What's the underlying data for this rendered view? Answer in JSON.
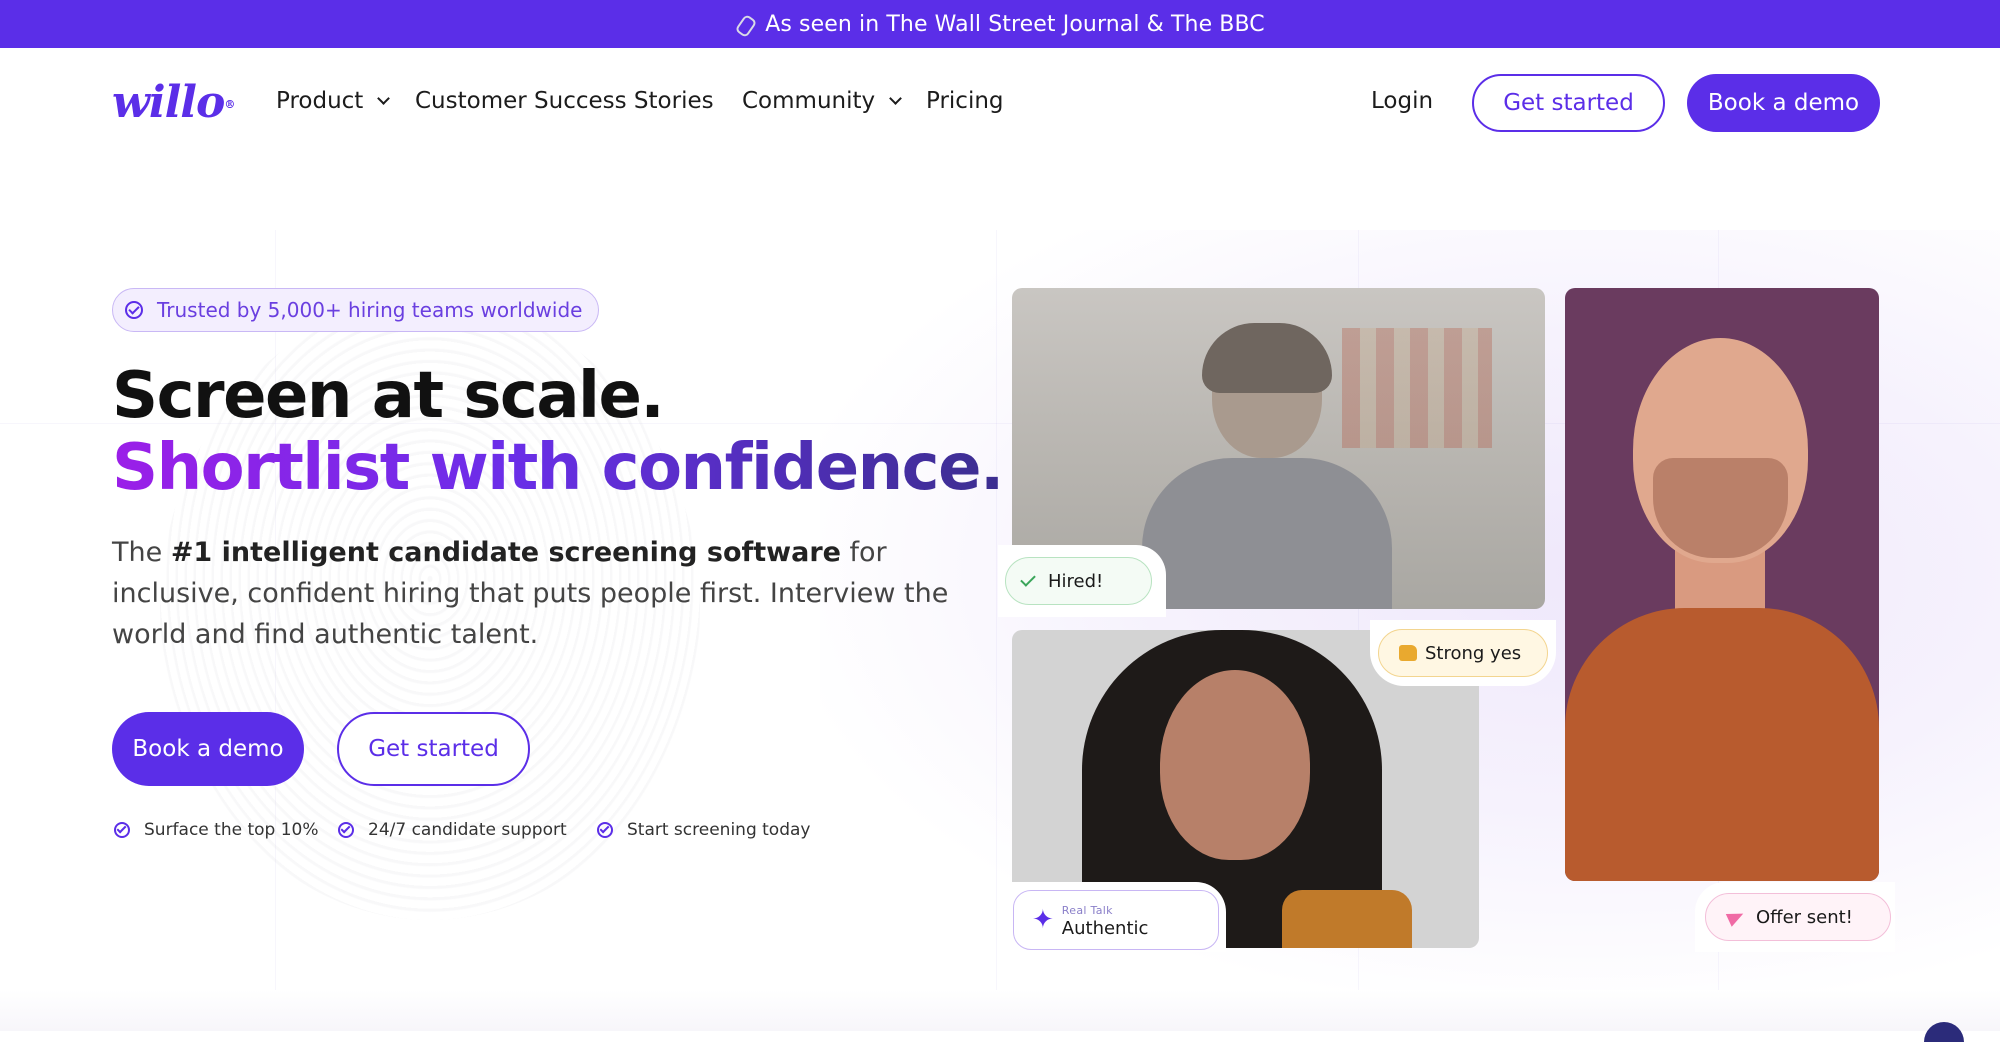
{
  "banner": {
    "text": "As seen in The Wall Street Journal & The BBC",
    "icon": "paperclip-icon"
  },
  "nav": {
    "logo": "willo",
    "logo_mark": "®",
    "items": [
      {
        "label": "Product",
        "has_dropdown": true
      },
      {
        "label": "Customer Success Stories",
        "has_dropdown": false
      },
      {
        "label": "Community",
        "has_dropdown": true
      },
      {
        "label": "Pricing",
        "has_dropdown": false
      }
    ],
    "login": "Login",
    "get_started": "Get started",
    "book_demo": "Book a demo"
  },
  "hero": {
    "badge": "Trusted by 5,000+ hiring teams worldwide",
    "title_line1": "Screen at scale.",
    "title_line2": "Shortlist with confidence.",
    "sub_pre": "The ",
    "sub_bold": "#1 intelligent candidate screening software",
    "sub_post": " for inclusive, confident hiring that puts people first. Interview the world and find authentic talent.",
    "cta_primary": "Book a demo",
    "cta_secondary": "Get started",
    "features": [
      "Surface the top 10%",
      "24/7 candidate support",
      "Start screening today"
    ]
  },
  "cards": {
    "hired": "Hired!",
    "strong_yes": "Strong yes",
    "real_talk": "Real Talk",
    "authentic": "Authentic",
    "offer_sent": "Offer sent!"
  },
  "colors": {
    "brand": "#5b2ee8",
    "gradient_start": "#9b1fe8",
    "gradient_end": "#3b2e8f",
    "hired_green": "#3aa55a",
    "strong_amber": "#e9a92f",
    "offer_pink": "#f06aa5"
  }
}
